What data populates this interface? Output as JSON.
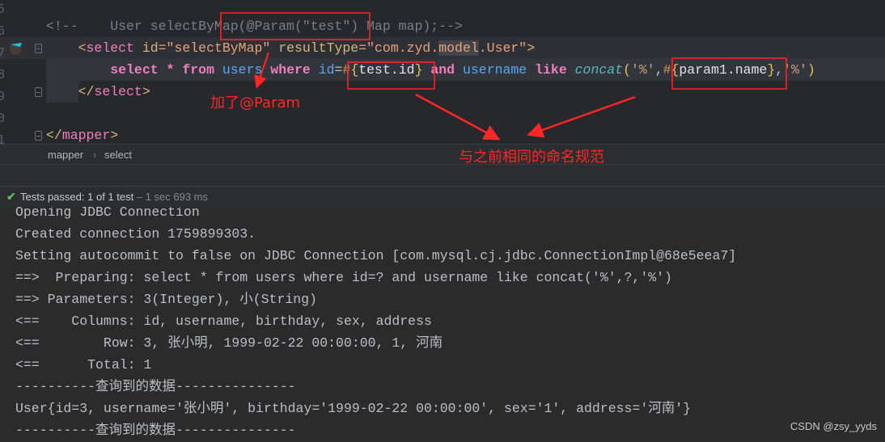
{
  "editor": {
    "gutter": [
      "5",
      "6",
      "7",
      "8",
      "9",
      "0",
      "1"
    ],
    "lines": [
      {
        "tokens": [
          {
            "c": "comment",
            "t": "<!--    User selectByMap(@Param(\"test\") Map map);-->"
          }
        ]
      },
      {
        "tokens": [
          {
            "c": "plain",
            "t": "    "
          },
          {
            "c": "bracket",
            "t": "<"
          },
          {
            "c": "tag",
            "t": "select"
          },
          {
            "c": "plain",
            "t": " "
          },
          {
            "c": "attr",
            "t": "id"
          },
          {
            "c": "str",
            "t": "=\"selectByMap\""
          },
          {
            "c": "plain",
            "t": " "
          },
          {
            "c": "attr",
            "t": "resultType"
          },
          {
            "c": "str",
            "t": "=\"com.zyd."
          },
          {
            "c": "str sel",
            "t": "model"
          },
          {
            "c": "str",
            "t": ".User\""
          },
          {
            "c": "bracket",
            "t": ">"
          }
        ]
      },
      {
        "tokens": [
          {
            "c": "plain",
            "t": "        "
          },
          {
            "c": "kw",
            "t": "select"
          },
          {
            "c": "plain",
            "t": " "
          },
          {
            "c": "kw",
            "t": "*"
          },
          {
            "c": "plain",
            "t": " "
          },
          {
            "c": "kw",
            "t": "from"
          },
          {
            "c": "plain",
            "t": " "
          },
          {
            "c": "ident",
            "t": "users"
          },
          {
            "c": "plain",
            "t": " "
          },
          {
            "c": "kw",
            "t": "where"
          },
          {
            "c": "plain",
            "t": " "
          },
          {
            "c": "ident",
            "t": "id"
          },
          {
            "c": "punct",
            "t": "="
          },
          {
            "c": "hash",
            "t": "#"
          },
          {
            "c": "brace",
            "t": "{"
          },
          {
            "c": "plain",
            "t": "test.id"
          },
          {
            "c": "brace",
            "t": "}"
          },
          {
            "c": "plain",
            "t": " "
          },
          {
            "c": "kw",
            "t": "and"
          },
          {
            "c": "plain",
            "t": " "
          },
          {
            "c": "ident",
            "t": "username"
          },
          {
            "c": "plain",
            "t": " "
          },
          {
            "c": "kw",
            "t": "like"
          },
          {
            "c": "plain",
            "t": " "
          },
          {
            "c": "func",
            "t": "concat"
          },
          {
            "c": "brace",
            "t": "("
          },
          {
            "c": "sq",
            "t": "'%'"
          },
          {
            "c": "punct",
            "t": ","
          },
          {
            "c": "hash",
            "t": "#"
          },
          {
            "c": "brace",
            "t": "{"
          },
          {
            "c": "plain",
            "t": "param1.name"
          },
          {
            "c": "brace",
            "t": "}"
          },
          {
            "c": "punct",
            "t": ","
          },
          {
            "c": "sq",
            "t": "'%'"
          },
          {
            "c": "brace",
            "t": ")"
          }
        ]
      },
      {
        "tokens": [
          {
            "c": "plain",
            "t": "    "
          },
          {
            "c": "bracket",
            "t": "</"
          },
          {
            "c": "tag",
            "t": "select"
          },
          {
            "c": "bracket",
            "t": ">"
          }
        ]
      },
      {
        "tokens": []
      },
      {
        "tokens": [
          {
            "c": "bracket",
            "t": "</"
          },
          {
            "c": "tag",
            "t": "mapper"
          },
          {
            "c": "bracket",
            "t": ">"
          }
        ]
      }
    ]
  },
  "breadcrumb": {
    "items": [
      "mapper",
      "select"
    ],
    "separator": "›"
  },
  "test_status": {
    "label": "Tests passed:",
    "passed": "1",
    "total": "of 1 test",
    "duration": "– 1 sec 693 ms",
    "icon": "check-icon",
    "color": "#5fb865"
  },
  "console": {
    "lines": [
      "Opening JDBC Connection",
      "Created connection 1759899303.",
      "Setting autocommit to false on JDBC Connection [com.mysql.cj.jdbc.ConnectionImpl@68e5eea7]",
      "==>  Preparing: select * from users where id=? and username like concat('%',?,'%')",
      "==> Parameters: 3(Integer), 小(String)",
      "<==    Columns: id, username, birthday, sex, address",
      "<==        Row: 3, 张小明, 1999-02-22 00:00:00, 1, 河南",
      "<==      Total: 1",
      "----------查询到的数据---------------",
      "User{id=3, username='张小明', birthday='1999-02-22 00:00:00', sex='1', address='河南'}",
      "----------查询到的数据---------------"
    ]
  },
  "annotations": {
    "param_note": "加了@Param",
    "naming_note": "与之前相同的命名规范",
    "color": "#ff2626"
  },
  "watermark": "CSDN @zsy_yyds"
}
